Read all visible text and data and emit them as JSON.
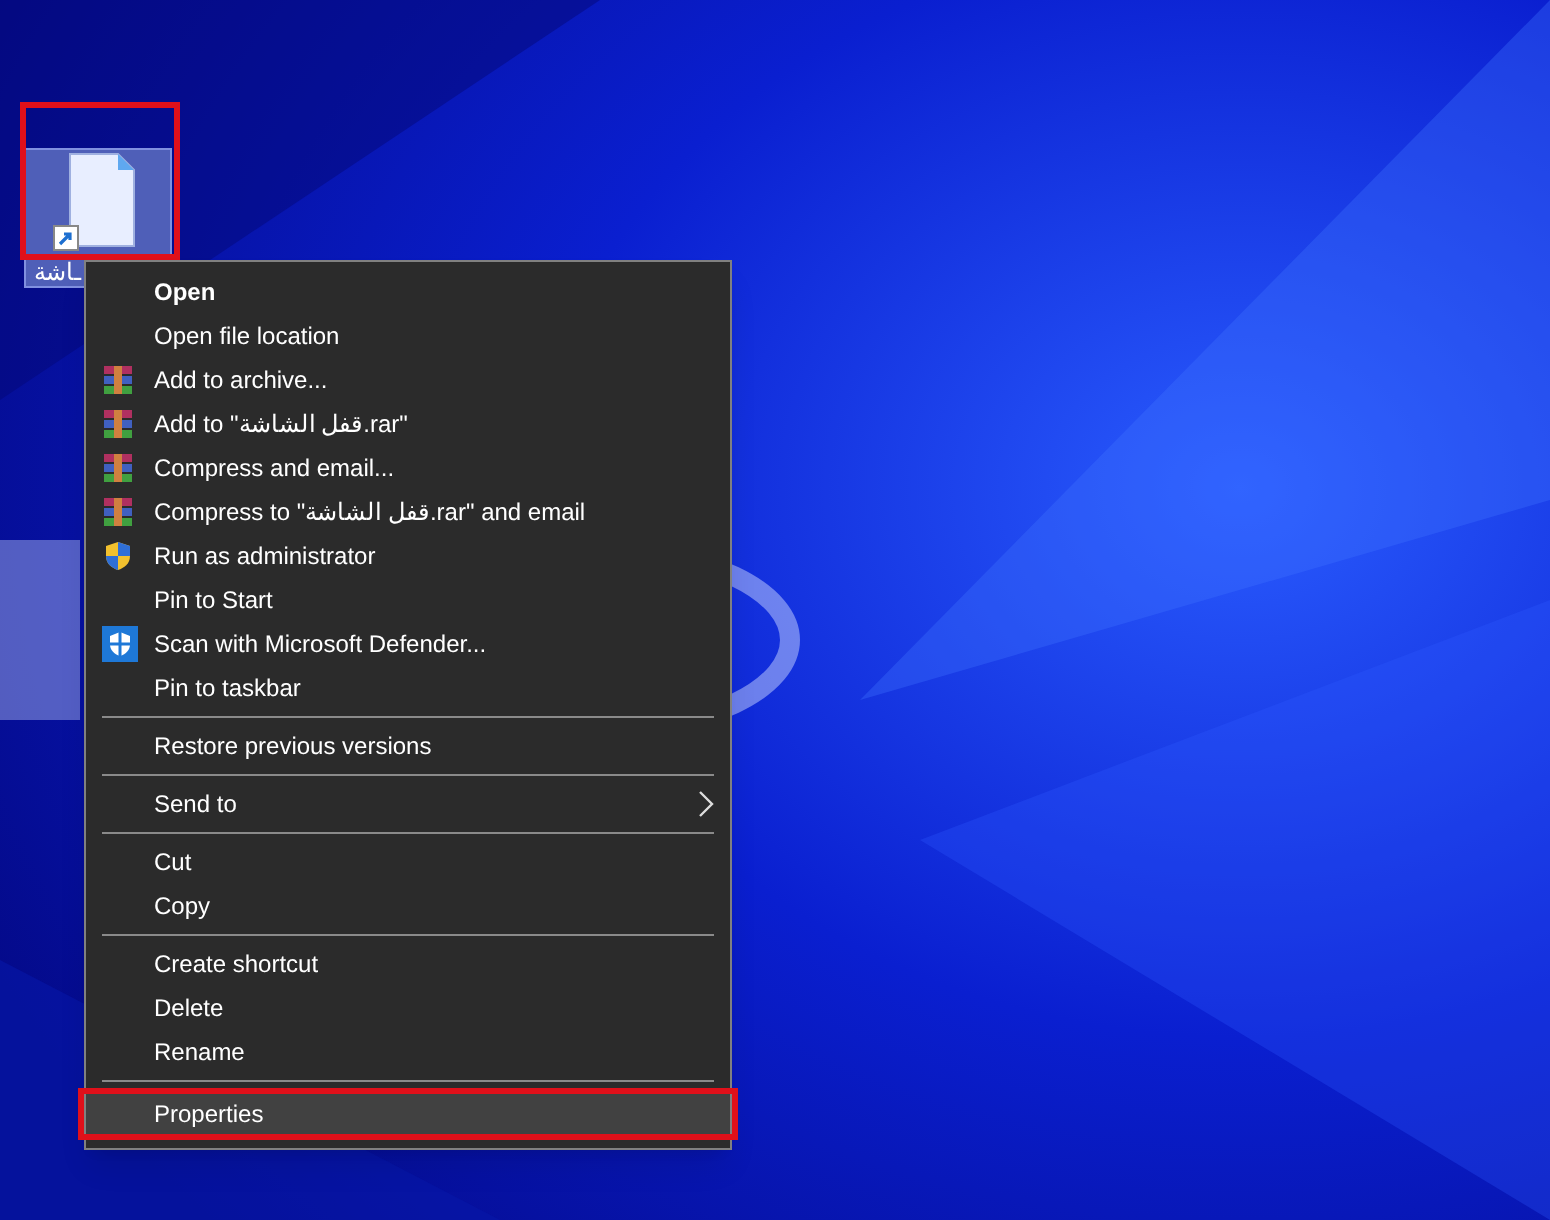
{
  "desktop_icon": {
    "label": "ـاشة",
    "selected": true,
    "annotated": true
  },
  "context_menu": {
    "items": [
      {
        "kind": "default",
        "label": "Open",
        "selected": false,
        "annotated": false
      },
      {
        "kind": "plain",
        "label": "Open file location",
        "selected": false,
        "annotated": false
      },
      {
        "kind": "winrar",
        "label": "Add to archive...",
        "selected": false,
        "annotated": false
      },
      {
        "kind": "winrar",
        "label": "Add to \"قفل الشاشة.rar\"",
        "selected": false,
        "annotated": false
      },
      {
        "kind": "winrar",
        "label": "Compress and email...",
        "selected": false,
        "annotated": false
      },
      {
        "kind": "winrar",
        "label": "Compress to \"قفل الشاشة.rar\" and email",
        "selected": false,
        "annotated": false
      },
      {
        "kind": "uac",
        "label": "Run as administrator",
        "selected": false,
        "annotated": false
      },
      {
        "kind": "plain",
        "label": "Pin to Start",
        "selected": false,
        "annotated": false
      },
      {
        "kind": "defender",
        "label": "Scan with Microsoft Defender...",
        "selected": false,
        "annotated": false
      },
      {
        "kind": "plain",
        "label": "Pin to taskbar",
        "selected": false,
        "annotated": false
      },
      {
        "kind": "separator"
      },
      {
        "kind": "plain",
        "label": "Restore previous versions",
        "selected": false,
        "annotated": false
      },
      {
        "kind": "separator"
      },
      {
        "kind": "submenu",
        "label": "Send to",
        "selected": false,
        "annotated": false
      },
      {
        "kind": "separator"
      },
      {
        "kind": "plain",
        "label": "Cut",
        "selected": false,
        "annotated": false
      },
      {
        "kind": "plain",
        "label": "Copy",
        "selected": false,
        "annotated": false
      },
      {
        "kind": "separator"
      },
      {
        "kind": "plain",
        "label": "Create shortcut",
        "selected": false,
        "annotated": false
      },
      {
        "kind": "plain",
        "label": "Delete",
        "selected": false,
        "annotated": false
      },
      {
        "kind": "plain",
        "label": "Rename",
        "selected": false,
        "annotated": false
      },
      {
        "kind": "separator"
      },
      {
        "kind": "plain",
        "label": "Properties",
        "selected": true,
        "annotated": true
      }
    ]
  }
}
